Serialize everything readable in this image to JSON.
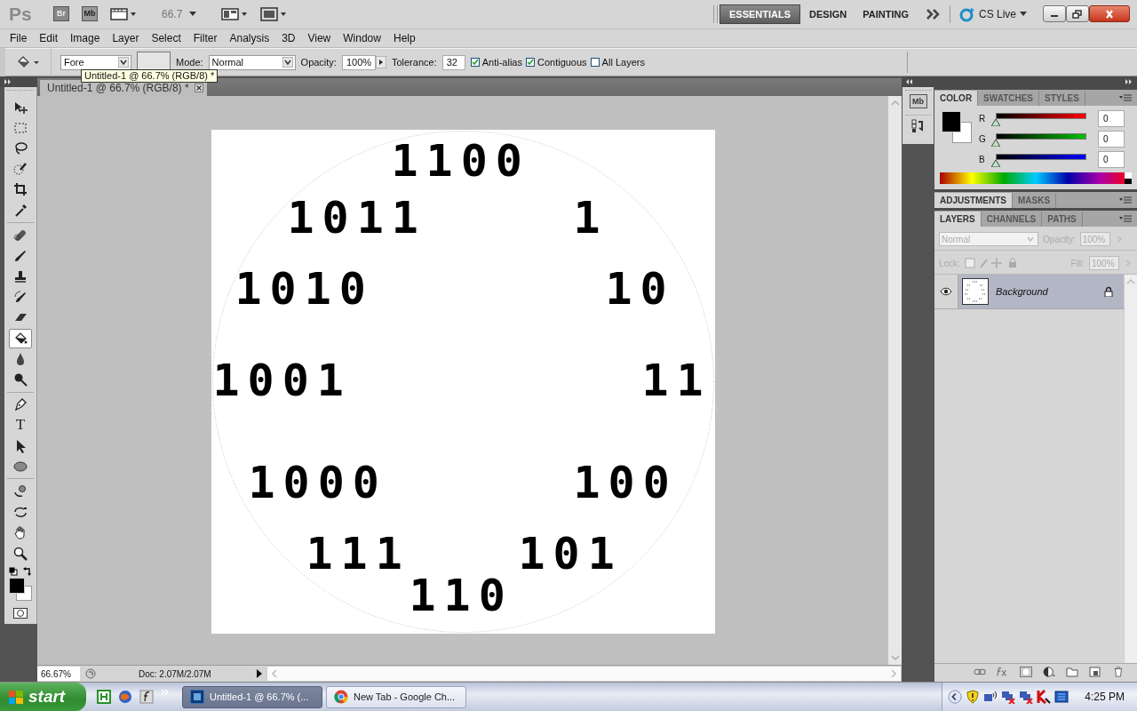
{
  "app_bar": {
    "logo": "Ps",
    "bridge": "Br",
    "mini_bridge": "Mb",
    "zoom": "66.7",
    "cs_live": "CS Live",
    "workspaces": [
      {
        "label": "ESSENTIALS",
        "selected": true
      },
      {
        "label": "DESIGN",
        "selected": false
      },
      {
        "label": "PAINTING",
        "selected": false
      }
    ]
  },
  "menu": [
    "File",
    "Edit",
    "Image",
    "Layer",
    "Select",
    "Filter",
    "Analysis",
    "3D",
    "View",
    "Window",
    "Help"
  ],
  "options_bar": {
    "fill_source": "Fore",
    "mode_label": "Mode:",
    "mode": "Normal",
    "opacity_label": "Opacity:",
    "opacity": "100%",
    "tolerance_label": "Tolerance:",
    "tolerance": "32",
    "checkboxes": [
      {
        "label": "Anti-alias",
        "checked": true
      },
      {
        "label": "Contiguous",
        "checked": true
      },
      {
        "label": "All Layers",
        "checked": false
      }
    ]
  },
  "tooltip": "Untitled-1 @ 66.7% (RGB/8) *",
  "tools": [
    {
      "kind": "move",
      "selected": false
    },
    {
      "kind": "marquee",
      "selected": false
    },
    {
      "kind": "lasso",
      "selected": false
    },
    {
      "kind": "quick",
      "selected": false
    },
    {
      "kind": "crop",
      "selected": false
    },
    {
      "kind": "eyedropper",
      "selected": false
    },
    {
      "kind": "healing",
      "selected": false
    },
    {
      "kind": "brush",
      "selected": false
    },
    {
      "kind": "stamp",
      "selected": false
    },
    {
      "kind": "history",
      "selected": false
    },
    {
      "kind": "eraser",
      "selected": false
    },
    {
      "kind": "bucket",
      "selected": true
    },
    {
      "kind": "blur",
      "selected": false
    },
    {
      "kind": "dodge",
      "selected": false
    },
    {
      "kind": "pen",
      "selected": false
    },
    {
      "kind": "type",
      "label": "T",
      "selected": false
    },
    {
      "kind": "path",
      "selected": false
    },
    {
      "kind": "ellipse",
      "selected": false
    },
    {
      "kind": "rotate",
      "selected": false
    },
    {
      "kind": "orbit",
      "selected": false
    },
    {
      "kind": "hand",
      "selected": false
    },
    {
      "kind": "zoom",
      "selected": false
    }
  ],
  "document": {
    "tab": "Untitled-1 @ 66.7% (RGB/8) *",
    "numbers": [
      "1100",
      "1011",
      "1",
      "1010",
      "10",
      "1001",
      "11",
      "1000",
      "100",
      "111",
      "101",
      "110"
    ]
  },
  "status_bar": {
    "zoom": "66.67%",
    "doc": "Doc: 2.07M/2.07M"
  },
  "color_panel": {
    "tabs": [
      {
        "label": "COLOR",
        "selected": true
      },
      {
        "label": "SWATCHES",
        "selected": false
      },
      {
        "label": "STYLES",
        "selected": false
      }
    ],
    "channels": [
      {
        "label": "R",
        "level": 0,
        "value": "0"
      },
      {
        "label": "G",
        "level": 0,
        "value": "0"
      },
      {
        "label": "B",
        "level": 0,
        "value": "0"
      }
    ]
  },
  "dock": {
    "mini_bridge": "Mb"
  },
  "adjustments_panel": {
    "tabs": [
      {
        "label": "ADJUSTMENTS",
        "selected": true
      },
      {
        "label": "MASKS",
        "selected": false
      }
    ]
  },
  "layers_panel": {
    "tabs": [
      {
        "label": "LAYERS",
        "selected": true
      },
      {
        "label": "CHANNELS",
        "selected": false
      },
      {
        "label": "PATHS",
        "selected": false
      }
    ],
    "blend_mode": "Normal",
    "opacity_label": "Opacity:",
    "opacity": "100%",
    "lock_label": "Lock:",
    "fill_label": "Fill:",
    "fill": "100%",
    "layers": [
      {
        "name": "Background",
        "selected": true,
        "visible": true,
        "locked": true
      }
    ]
  },
  "taskbar": {
    "start": "start",
    "clock": "4:25 PM",
    "tasks": [
      {
        "kind": "photoshop",
        "label": "Untitled-1 @ 66.7% (...",
        "selected": true
      },
      {
        "kind": "chrome",
        "label": "New Tab - Google Ch...",
        "selected": false
      }
    ]
  }
}
